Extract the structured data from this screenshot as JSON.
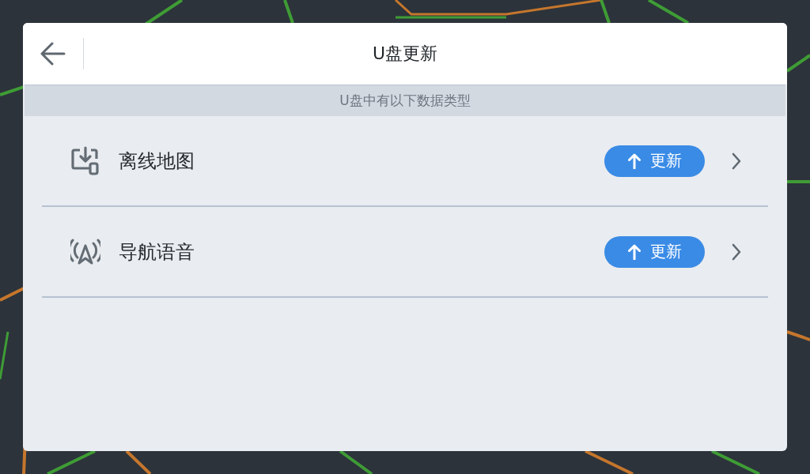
{
  "header": {
    "title": "U盘更新"
  },
  "subheader": "U盘中有以下数据类型",
  "items": [
    {
      "kind": "map",
      "label": "离线地图",
      "button": "更新"
    },
    {
      "kind": "voice",
      "label": "导航语音",
      "button": "更新"
    }
  ]
}
